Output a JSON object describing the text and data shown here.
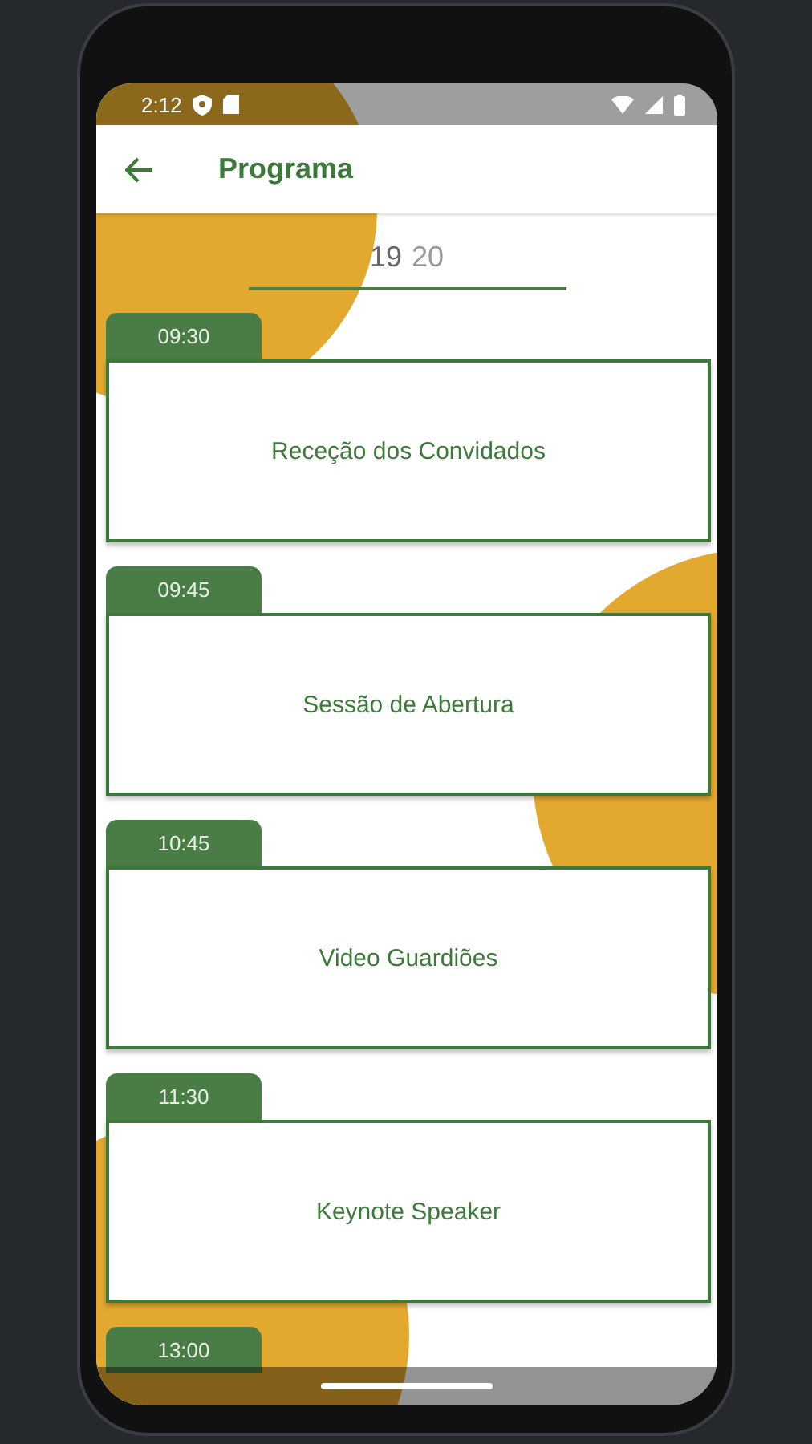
{
  "status_bar": {
    "time": "2:12"
  },
  "app_bar": {
    "title": "Programa"
  },
  "days": [
    {
      "label": "19",
      "selected": true
    },
    {
      "label": "20",
      "selected": false
    }
  ],
  "events": [
    {
      "time": "09:30",
      "title": "Receção dos Convidados"
    },
    {
      "time": "09:45",
      "title": "Sessão de Abertura"
    },
    {
      "time": "10:45",
      "title": "Video Guardiões"
    },
    {
      "time": "11:30",
      "title": "Keynote Speaker"
    },
    {
      "time": "13:00"
    }
  ]
}
